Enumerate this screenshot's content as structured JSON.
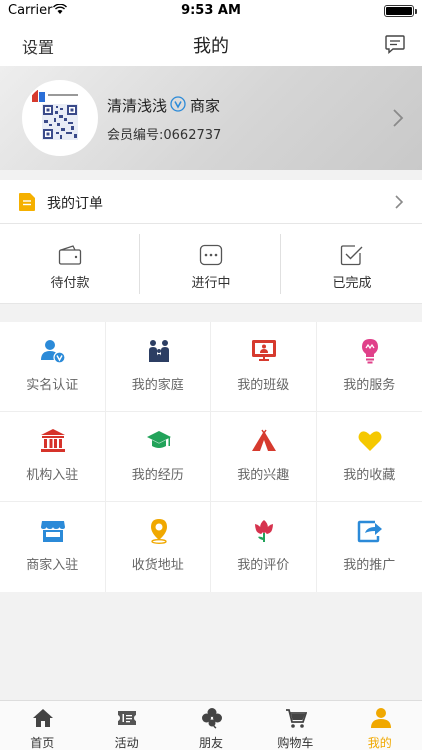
{
  "status_bar": {
    "carrier": "Carrier",
    "time": "9:53 AM"
  },
  "nav": {
    "settings": "设置",
    "title": "我的"
  },
  "profile": {
    "name": "清清浅浅",
    "role": "商家",
    "member_no": "会员编号:0662737"
  },
  "orders": {
    "title": "我的订单",
    "statuses": [
      {
        "label": "待付款",
        "icon": "wallet-icon"
      },
      {
        "label": "进行中",
        "icon": "dots-icon"
      },
      {
        "label": "已完成",
        "icon": "check-icon"
      }
    ]
  },
  "grid": [
    {
      "label": "实名认证",
      "icon": "verify-user-icon",
      "color": "#2b8ad8"
    },
    {
      "label": "我的家庭",
      "icon": "family-icon",
      "color": "#2c3e63"
    },
    {
      "label": "我的班级",
      "icon": "class-icon",
      "color": "#d63a2e"
    },
    {
      "label": "我的服务",
      "icon": "bulb-icon",
      "color": "#e0408a"
    },
    {
      "label": "机构入驻",
      "icon": "institution-icon",
      "color": "#d6332a"
    },
    {
      "label": "我的经历",
      "icon": "graduation-icon",
      "color": "#22a35a"
    },
    {
      "label": "我的兴趣",
      "icon": "tent-icon",
      "color": "#d63a2e"
    },
    {
      "label": "我的收藏",
      "icon": "heart-icon",
      "color": "#f5c800"
    },
    {
      "label": "商家入驻",
      "icon": "shop-icon",
      "color": "#2b8ad8"
    },
    {
      "label": "收货地址",
      "icon": "location-icon",
      "color": "#f0a800"
    },
    {
      "label": "我的评价",
      "icon": "flower-icon",
      "color": "#d6334e"
    },
    {
      "label": "我的推广",
      "icon": "share-icon",
      "color": "#2b8ad8"
    }
  ],
  "tabs": [
    {
      "label": "首页",
      "icon": "home-icon"
    },
    {
      "label": "活动",
      "icon": "ticket-icon"
    },
    {
      "label": "朋友",
      "icon": "clover-icon"
    },
    {
      "label": "购物车",
      "icon": "cart-icon"
    },
    {
      "label": "我的",
      "icon": "user-icon"
    }
  ],
  "colors": {
    "accent": "#f0a800",
    "text": "#333333"
  }
}
